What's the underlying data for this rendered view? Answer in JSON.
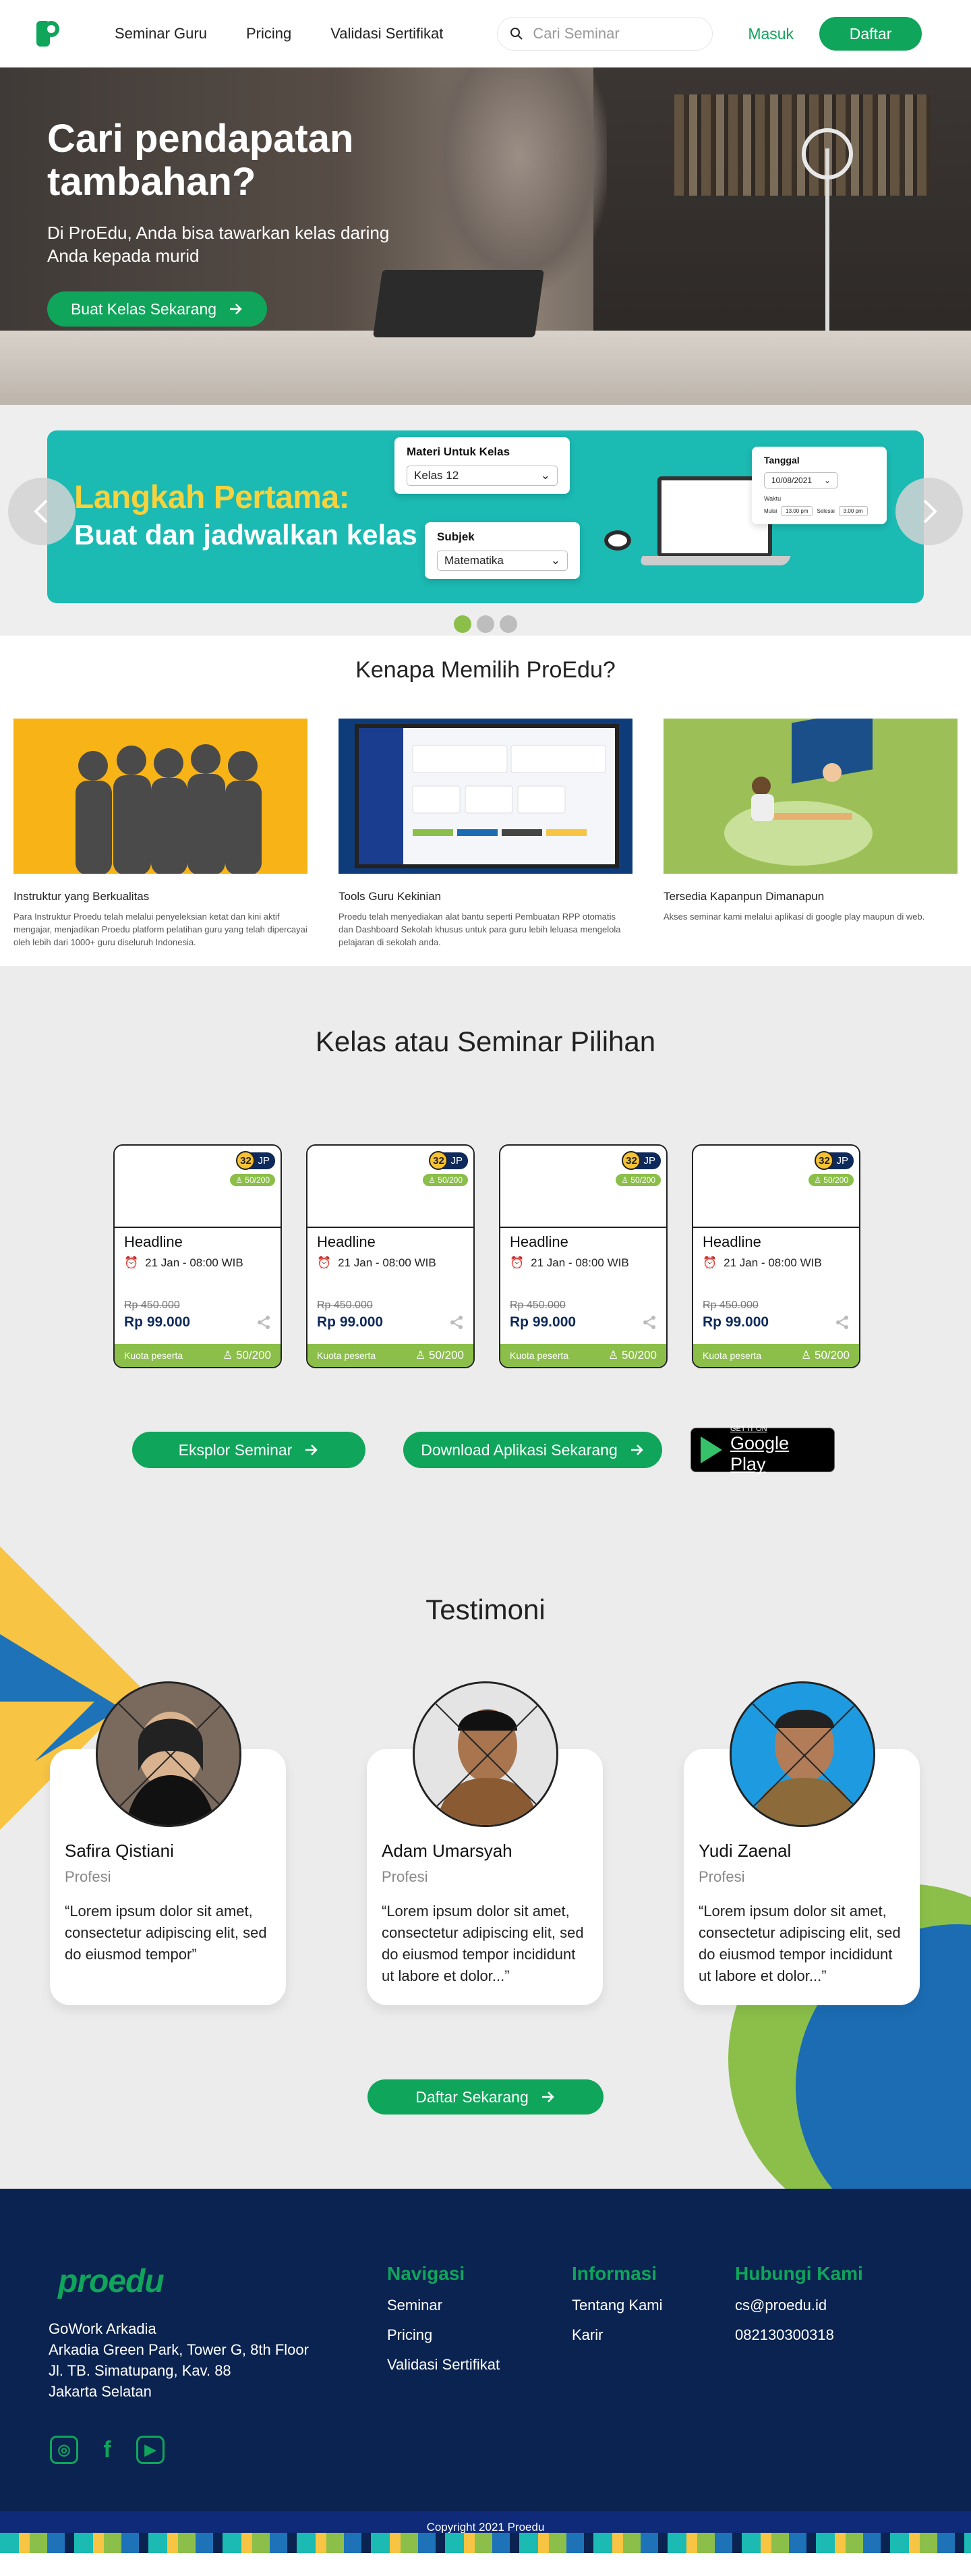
{
  "nav": {
    "links": [
      "Seminar Guru",
      "Pricing",
      "Validasi Sertifikat"
    ],
    "search_placeholder": "Cari Seminar",
    "login": "Masuk",
    "register": "Daftar"
  },
  "hero": {
    "title": "Cari pendapatan tambahan?",
    "subtitle": "Di ProEdu, Anda bisa tawarkan kelas daring Anda kepada murid",
    "button": "Buat Kelas Sekarang"
  },
  "carousel": {
    "title_line1": "Langkah Pertama:",
    "title_line2": "Buat dan jadwalkan kelas",
    "materi_label": "Materi Untuk Kelas",
    "materi_value": "Kelas 12",
    "subjek_label": "Subjek",
    "subjek_value": "Matematika",
    "tanggal_label": "Tanggal",
    "tanggal_value": "10/08/2021",
    "waktu_label": "Waktu",
    "mulai_label": "Mulai",
    "mulai_value": "13.00 pm",
    "selesai_label": "Selesai",
    "selesai_value": "3.00 pm",
    "active_slide": 1,
    "slide_count": 3
  },
  "why": {
    "heading": "Kenapa Memilih ProEdu?",
    "items": [
      {
        "title": "Instruktur yang Berkualitas",
        "text": "Para Instruktur Proedu telah melalui penyeleksian ketat dan kini aktif mengajar, menjadikan Proedu platform pelatihan guru yang telah dipercayai oleh lebih dari 1000+ guru  diseluruh Indonesia."
      },
      {
        "title": "Tools Guru Kekinian",
        "text": "Proedu telah menyediakan alat bantu seperti Pembuatan RPP otomatis dan Dashboard Sekolah khusus untuk para guru lebih leluasa mengelola pelajaran di sekolah anda."
      },
      {
        "title": "Tersedia Kapanpun Dimanapun",
        "text": "Akses seminar kami melalui aplikasi di google play maupun di web."
      }
    ]
  },
  "classes": {
    "heading": "Kelas atau Seminar  Pilihan",
    "cards": [
      {
        "jp_num": "32",
        "jp": "JP",
        "seats": "50/200",
        "headline": "Headline",
        "date": "21 Jan - 08:00 WIB",
        "old_price": "Rp 450.000",
        "price": "Rp 99.000",
        "quota_label": "Kuota peserta",
        "quota": "50/200"
      },
      {
        "jp_num": "32",
        "jp": "JP",
        "seats": "50/200",
        "headline": "Headline",
        "date": "21 Jan - 08:00 WIB",
        "old_price": "Rp 450.000",
        "price": "Rp 99.000",
        "quota_label": "Kuota peserta",
        "quota": "50/200"
      },
      {
        "jp_num": "32",
        "jp": "JP",
        "seats": "50/200",
        "headline": "Headline",
        "date": "21 Jan - 08:00 WIB",
        "old_price": "Rp 450.000",
        "price": "Rp 99.000",
        "quota_label": "Kuota peserta",
        "quota": "50/200"
      },
      {
        "jp_num": "32",
        "jp": "JP",
        "seats": "50/200",
        "headline": "Headline",
        "date": "21 Jan - 08:00 WIB",
        "old_price": "Rp 450.000",
        "price": "Rp 99.000",
        "quota_label": "Kuota peserta",
        "quota": "50/200"
      }
    ],
    "explore_button": "Eksplor Seminar",
    "download_button": "Download Aplikasi Sekarang",
    "gplay_small": "GET IT ON",
    "gplay_big": "Google Play"
  },
  "testimoni": {
    "heading": "Testimoni",
    "items": [
      {
        "name": "Safira Qistiani",
        "role": "Profesi",
        "quote": "“Lorem ipsum dolor sit amet, consectetur adipiscing elit, sed do eiusmod tempor”"
      },
      {
        "name": "Adam Umarsyah",
        "role": "Profesi",
        "quote": "“Lorem ipsum dolor sit amet, consectetur adipiscing elit, sed do eiusmod tempor incididunt ut labore et dolor...”"
      },
      {
        "name": "Yudi Zaenal",
        "role": "Profesi",
        "quote": "“Lorem ipsum dolor sit amet, consectetur adipiscing elit, sed do eiusmod tempor incididunt ut labore et dolor...”"
      }
    ],
    "button": "Daftar Sekarang"
  },
  "footer": {
    "logo": "proedu",
    "address": [
      "GoWork Arkadia",
      "Arkadia Green Park, Tower G, 8th Floor",
      "Jl. TB. Simatupang, Kav. 88",
      "Jakarta Selatan"
    ],
    "nav_title": "Navigasi",
    "nav_links": [
      "Seminar",
      "Pricing",
      "Validasi Sertifikat"
    ],
    "info_title": "Informasi",
    "info_links": [
      "Tentang Kami",
      "Karir"
    ],
    "contact_title": "Hubungi Kami",
    "contact": [
      "cs@proedu.id",
      "082130300318"
    ],
    "copyright": "Copyright 2021 Proedu"
  },
  "colors": {
    "brand": "#0fa55a",
    "navy": "#0b2350",
    "lime": "#8bbf4a",
    "teal": "#1bbab3",
    "yellow": "#f7c443"
  }
}
